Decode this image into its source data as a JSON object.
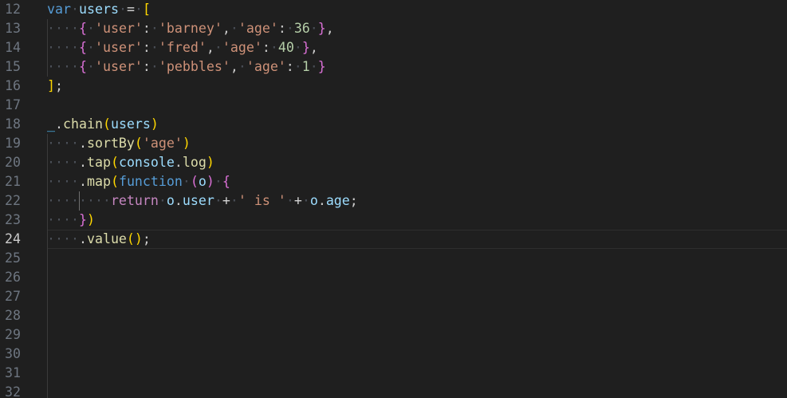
{
  "editor": {
    "active_line": "24",
    "line_numbers": [
      "12",
      "13",
      "14",
      "15",
      "16",
      "17",
      "18",
      "19",
      "20",
      "21",
      "22",
      "23",
      "24",
      "25",
      "26",
      "27",
      "28",
      "29",
      "30",
      "31",
      "32"
    ],
    "code": {
      "l12": {
        "kw": "var",
        "ident": "users",
        "eq": "=",
        "open": "["
      },
      "l13": {
        "open": "{",
        "k1": "'user'",
        "colon1": ":",
        "v1": "'barney'",
        "comma1": ",",
        "k2": "'age'",
        "colon2": ":",
        "v2": "36",
        "close": "}",
        "comma2": ","
      },
      "l14": {
        "open": "{",
        "k1": "'user'",
        "colon1": ":",
        "v1": "'fred'",
        "comma1": ",",
        "k2": "'age'",
        "colon2": ":",
        "v2": "40",
        "close": "}",
        "comma2": ","
      },
      "l15": {
        "open": "{",
        "k1": "'user'",
        "colon1": ":",
        "v1": "'pebbles'",
        "comma1": ",",
        "k2": "'age'",
        "colon2": ":",
        "v2": "1",
        "close": "}"
      },
      "l16": {
        "close": "]",
        "semi": ";"
      },
      "l18": {
        "under": "_",
        "dot": ".",
        "fn": "chain",
        "open": "(",
        "arg": "users",
        "close": ")"
      },
      "l19": {
        "dot": ".",
        "fn": "sortBy",
        "open": "(",
        "arg": "'age'",
        "close": ")"
      },
      "l20": {
        "dot": ".",
        "fn": "tap",
        "open": "(",
        "obj": "console",
        "dot2": ".",
        "prop": "log",
        "close": ")"
      },
      "l21": {
        "dot": ".",
        "fn": "map",
        "open": "(",
        "kw": "function",
        "popen": "(",
        "param": "o",
        "pclose": ")",
        "brace": "{"
      },
      "l22": {
        "kw": "return",
        "obj": "o",
        "dot": ".",
        "prop": "user",
        "plus1": "+",
        "str": "' is '",
        "plus2": "+",
        "obj2": "o",
        "dot2": ".",
        "prop2": "age",
        "semi": ";"
      },
      "l23": {
        "brace": "}",
        "close": ")"
      },
      "l24": {
        "dot": ".",
        "fn": "value",
        "open": "(",
        "close": ")",
        "semi": ";"
      }
    }
  }
}
